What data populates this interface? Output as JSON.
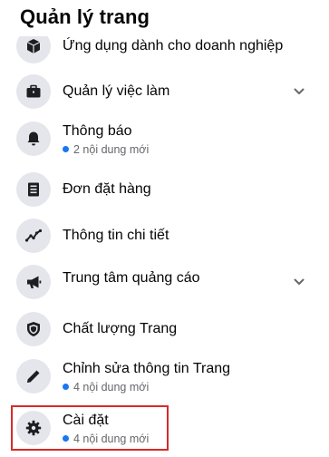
{
  "header": {
    "title": "Quản lý trang"
  },
  "items": [
    {
      "label": "Ứng dụng dành cho doanh nghiệp",
      "icon": "cube-icon",
      "expandable": false
    },
    {
      "label": "Quản lý việc làm",
      "icon": "briefcase-icon",
      "expandable": true
    },
    {
      "label": "Thông báo",
      "icon": "bell-icon",
      "sub": "2 nội dung mới",
      "expandable": false
    },
    {
      "label": "Đơn đặt hàng",
      "icon": "orders-icon",
      "expandable": false
    },
    {
      "label": "Thông tin chi tiết",
      "icon": "insights-icon",
      "expandable": false
    },
    {
      "label": "Trung tâm quảng cáo",
      "icon": "megaphone-icon",
      "expandable": true
    },
    {
      "label": "Chất lượng Trang",
      "icon": "shield-icon",
      "expandable": false
    },
    {
      "label": "Chỉnh sửa thông tin Trang",
      "icon": "pencil-icon",
      "sub": "4 nội dung mới",
      "expandable": false
    },
    {
      "label": "Cài đặt",
      "icon": "gear-icon",
      "sub": "4 nội dung mới",
      "expandable": false
    }
  ],
  "colors": {
    "accent_dot": "#1877f2",
    "icon_bg": "#e4e6eb",
    "highlight": "#d72a2a",
    "subtext": "#65676b"
  }
}
